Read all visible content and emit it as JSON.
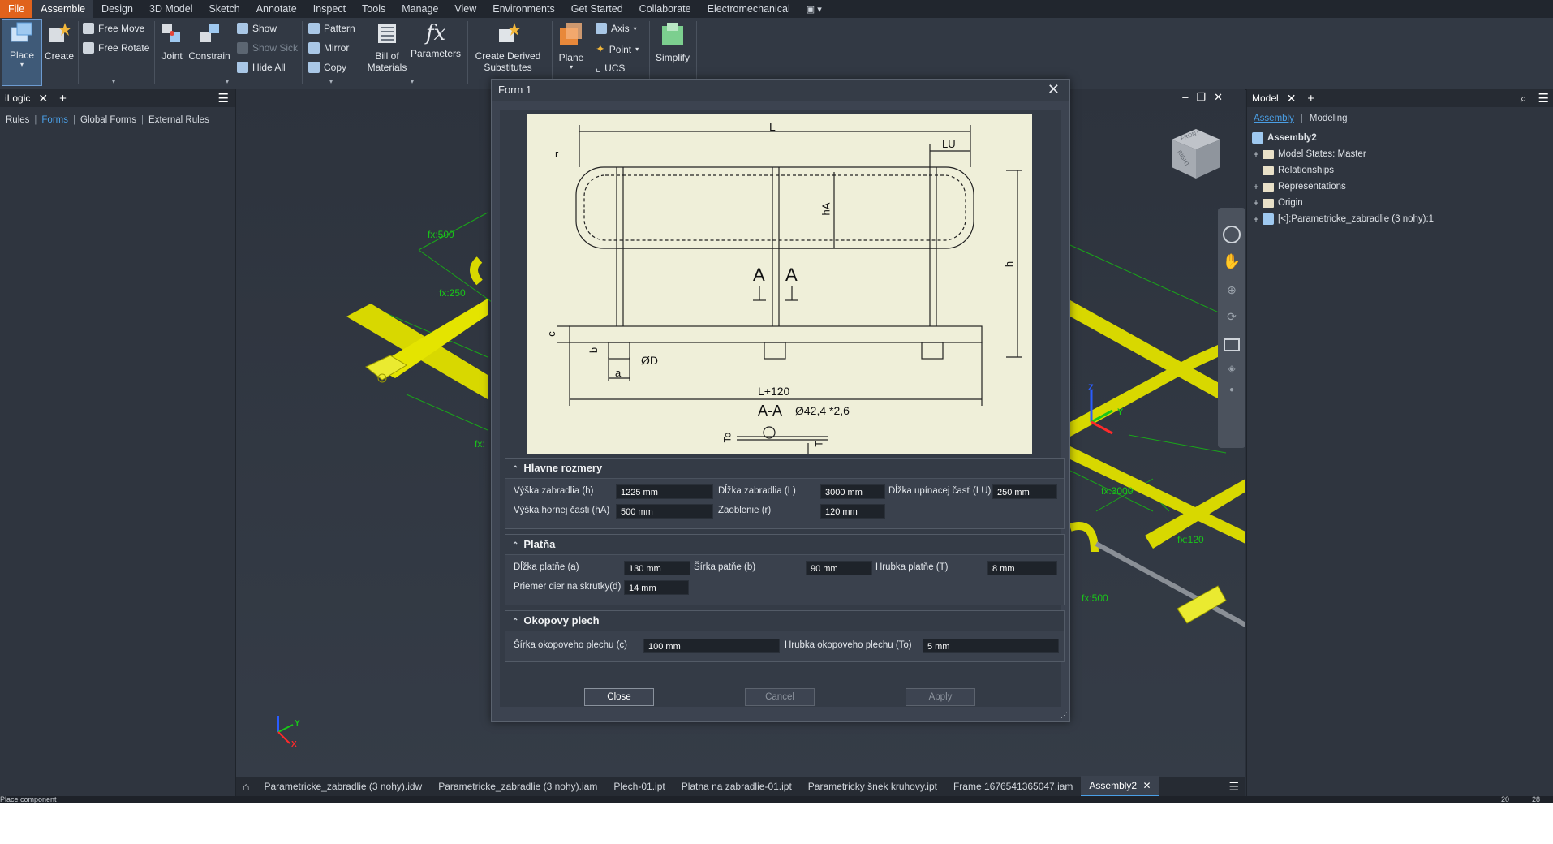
{
  "menu": [
    "File",
    "Assemble",
    "Design",
    "3D Model",
    "Sketch",
    "Annotate",
    "Inspect",
    "Tools",
    "Manage",
    "View",
    "Environments",
    "Get Started",
    "Collaborate",
    "Electromechanical"
  ],
  "ribbon": {
    "place": "Place",
    "create": "Create",
    "free_move": "Free Move",
    "free_rotate": "Free Rotate",
    "joint": "Joint",
    "constrain": "Constrain",
    "show": "Show",
    "show_sick": "Show Sick",
    "hide_all": "Hide All",
    "pattern": "Pattern",
    "mirror": "Mirror",
    "copy": "Copy",
    "bom_line1": "Bill of",
    "bom_line2": "Materials",
    "parameters": "Parameters",
    "derived_line1": "Create Derived",
    "derived_line2": "Substitutes",
    "plane": "Plane",
    "axis": "Axis",
    "point": "Point",
    "ucs": "UCS",
    "simplify": "Simplify"
  },
  "left_panel": {
    "tab": "iLogic",
    "links": [
      "Rules",
      "Forms",
      "Global Forms",
      "External Rules"
    ]
  },
  "right_panel": {
    "tab": "Model",
    "subtabs": [
      "Assembly",
      "Modeling"
    ],
    "tree": [
      "Assembly2",
      "Model States: Master",
      "Relationships",
      "Representations",
      "Origin",
      "[<]:Parametricke_zabradlie (3 nohy):1"
    ]
  },
  "viewport_labels": {
    "fx500_a": "fx:500",
    "fx250": "fx:250",
    "fx_cut": "fx:",
    "fx3000": "fx:3000",
    "fx120": "fx:120",
    "fx500_b": "fx:500",
    "cube_front": "FRONT",
    "cube_right": "RIGHT",
    "cube_top": "TOP",
    "axis_x": "X",
    "axis_y": "Y",
    "axis_z": "Z"
  },
  "dialog": {
    "title": "Form 1",
    "drawing": {
      "L": "L",
      "LU": "LU",
      "r": "r",
      "hA": "hA",
      "h": "h",
      "A_left": "A",
      "A_right": "A",
      "c": "c",
      "b": "b",
      "a": "a",
      "OD": "ØD",
      "L120": "L+120",
      "AA": "A-A",
      "pipe": "Ø42,4 *2,6",
      "To": "To",
      "T": "T"
    },
    "groups": [
      {
        "title": "Hlavne rozmery",
        "fields": [
          {
            "label": "Výška zabradlia (h)",
            "value": "1225 mm"
          },
          {
            "label": "Dĺžka zabradlia (L)",
            "value": "3000 mm"
          },
          {
            "label": "Dĺžka upínacej časť (LU)",
            "value": "250 mm"
          },
          {
            "label": "Výška hornej časti (hA)",
            "value": "500 mm"
          },
          {
            "label": "Zaoblenie (r)",
            "value": "120 mm"
          }
        ]
      },
      {
        "title": "Platňa",
        "fields": [
          {
            "label": "Dĺžka platňe (a)",
            "value": "130 mm"
          },
          {
            "label": "Šírka patňe (b)",
            "value": "90 mm"
          },
          {
            "label": "Hrubka platňe (T)",
            "value": "8 mm"
          },
          {
            "label": "Priemer dier na skrutky(d)",
            "value": "14 mm"
          }
        ]
      },
      {
        "title": "Okopovy plech",
        "fields": [
          {
            "label": "Šírka okopoveho plechu (c)",
            "value": "100 mm"
          },
          {
            "label": "Hrubka okopoveho plechu (To)",
            "value": "5 mm"
          }
        ]
      }
    ],
    "buttons": {
      "close": "Close",
      "cancel": "Cancel",
      "apply": "Apply"
    }
  },
  "doc_tabs": [
    "Parametricke_zabradlie (3 nohy).idw",
    "Parametricke_zabradlie (3 nohy).iam",
    "Plech-01.ipt",
    "Platna na zabradlie-01.ipt",
    "Parametricky šnek kruhovy.ipt",
    "Frame 1676541365047.iam",
    "Assembly2"
  ],
  "status": {
    "text": "Place component",
    "n1": "20",
    "n2": "28"
  },
  "colors": {
    "accent": "#4a9fe6",
    "file_tab": "#e0621c",
    "model_yellow": "#d8d800",
    "dimension_green": "#19a619"
  }
}
